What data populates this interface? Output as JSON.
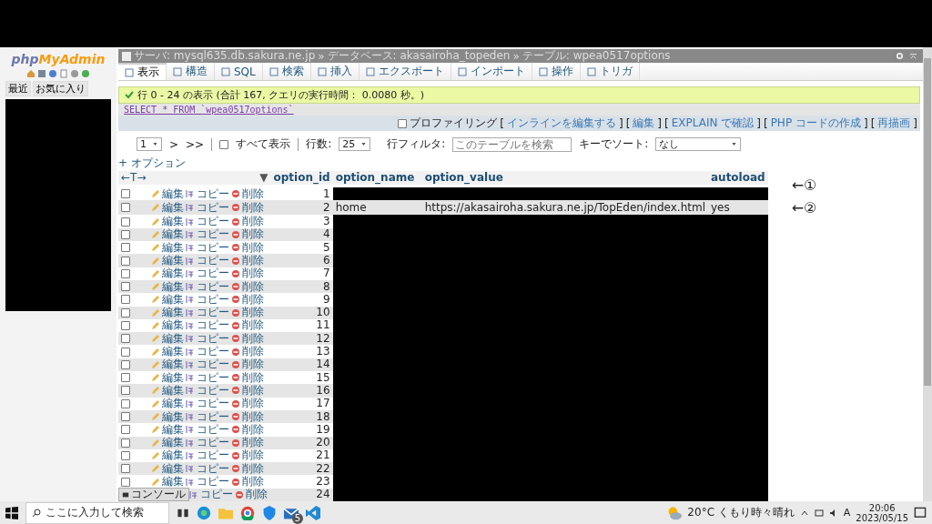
{
  "sidebar": {
    "logo_php": "php",
    "logo_myadmin": "MyAdmin",
    "tabs": [
      {
        "label": "最近"
      },
      {
        "label": "お気に入り"
      }
    ]
  },
  "breadcrumb": {
    "separator": "»",
    "items": [
      {
        "label": "サーバ: mysql635.db.sakura.ne.jp"
      },
      {
        "label": "データベース: akasairoha_topeden"
      },
      {
        "label": "テーブル: wpea0517options"
      }
    ]
  },
  "tabs": [
    {
      "label": "表示",
      "selected": true
    },
    {
      "label": "構造",
      "selected": false
    },
    {
      "label": "SQL",
      "selected": false
    },
    {
      "label": "検索",
      "selected": false
    },
    {
      "label": "挿入",
      "selected": false
    },
    {
      "label": "エクスポート",
      "selected": false
    },
    {
      "label": "インポート",
      "selected": false
    },
    {
      "label": "操作",
      "selected": false
    },
    {
      "label": "トリガ",
      "selected": false
    }
  ],
  "message": "行 0 - 24 の表示 (合計 167, クエリの実行時間： 0.0080 秒。)",
  "sql": "SELECT * FROM `wpea0517options`",
  "profiling": {
    "label": "プロファイリング",
    "checked": false,
    "open": "[",
    "close": "]",
    "links": [
      "インラインを編集する",
      "編集",
      "EXPLAIN で確認",
      "PHP コードの作成",
      "再描画"
    ]
  },
  "navigation": {
    "page": "1",
    "next": ">",
    "last": ">>",
    "show_all": {
      "label": "すべて表示",
      "checked": false
    },
    "rows_label": "行数:",
    "rows_value": "25",
    "filter_label": "行フィルタ:",
    "filter_placeholder": "このテーブルを検索",
    "sort_label": "キーでソート:",
    "sort_value": "なし"
  },
  "options_link": "+ オプション",
  "table": {
    "resize_handle": "←T→",
    "sort_marker": "▼",
    "columns": [
      "option_id",
      "option_name",
      "option_value",
      "autoload"
    ],
    "rows": [
      {
        "id": "1",
        "checked": false,
        "edit": "編集",
        "copy": "コピー",
        "delete": "削除",
        "redacted": true
      },
      {
        "id": "2",
        "checked": false,
        "edit": "編集",
        "copy": "コピー",
        "delete": "削除",
        "redacted": false,
        "name": "home",
        "value": "https://akasairoha.sakura.ne.jp/TopEden/index.html",
        "autoload": "yes"
      },
      {
        "id": "3",
        "checked": false,
        "edit": "編集",
        "copy": "コピー",
        "delete": "削除",
        "redacted": true
      },
      {
        "id": "4",
        "checked": false,
        "edit": "編集",
        "copy": "コピー",
        "delete": "削除",
        "redacted": true
      },
      {
        "id": "5",
        "checked": false,
        "edit": "編集",
        "copy": "コピー",
        "delete": "削除",
        "redacted": true
      },
      {
        "id": "6",
        "checked": false,
        "edit": "編集",
        "copy": "コピー",
        "delete": "削除",
        "redacted": true
      },
      {
        "id": "7",
        "checked": false,
        "edit": "編集",
        "copy": "コピー",
        "delete": "削除",
        "redacted": true
      },
      {
        "id": "8",
        "checked": false,
        "edit": "編集",
        "copy": "コピー",
        "delete": "削除",
        "redacted": true
      },
      {
        "id": "9",
        "checked": false,
        "edit": "編集",
        "copy": "コピー",
        "delete": "削除",
        "redacted": true
      },
      {
        "id": "10",
        "checked": false,
        "edit": "編集",
        "copy": "コピー",
        "delete": "削除",
        "redacted": true
      },
      {
        "id": "11",
        "checked": false,
        "edit": "編集",
        "copy": "コピー",
        "delete": "削除",
        "redacted": true
      },
      {
        "id": "12",
        "checked": false,
        "edit": "編集",
        "copy": "コピー",
        "delete": "削除",
        "redacted": true
      },
      {
        "id": "13",
        "checked": false,
        "edit": "編集",
        "copy": "コピー",
        "delete": "削除",
        "redacted": true
      },
      {
        "id": "14",
        "checked": false,
        "edit": "編集",
        "copy": "コピー",
        "delete": "削除",
        "redacted": true
      },
      {
        "id": "15",
        "checked": false,
        "edit": "編集",
        "copy": "コピー",
        "delete": "削除",
        "redacted": true
      },
      {
        "id": "16",
        "checked": false,
        "edit": "編集",
        "copy": "コピー",
        "delete": "削除",
        "redacted": true
      },
      {
        "id": "17",
        "checked": false,
        "edit": "編集",
        "copy": "コピー",
        "delete": "削除",
        "redacted": true
      },
      {
        "id": "18",
        "checked": false,
        "edit": "編集",
        "copy": "コピー",
        "delete": "削除",
        "redacted": true
      },
      {
        "id": "19",
        "checked": false,
        "edit": "編集",
        "copy": "コピー",
        "delete": "削除",
        "redacted": true
      },
      {
        "id": "20",
        "checked": false,
        "edit": "編集",
        "copy": "コピー",
        "delete": "削除",
        "redacted": true
      },
      {
        "id": "21",
        "checked": false,
        "edit": "編集",
        "copy": "コピー",
        "delete": "削除",
        "redacted": true
      },
      {
        "id": "22",
        "checked": false,
        "edit": "編集",
        "copy": "コピー",
        "delete": "削除",
        "redacted": true
      },
      {
        "id": "23",
        "checked": false,
        "edit": "編集",
        "copy": "コピー",
        "delete": "削除",
        "redacted": true
      },
      {
        "id": "24",
        "copy": "コピー",
        "delete": "削除",
        "redacted": true
      }
    ]
  },
  "annotations": [
    "←①",
    "←②"
  ],
  "console": "コンソール",
  "taskbar": {
    "search_placeholder": "ここに入力して検索",
    "mail_badge": "5",
    "weather": "20°C くもり時々晴れ",
    "ime": "A",
    "time": "20:06",
    "date": "2023/05/15"
  }
}
